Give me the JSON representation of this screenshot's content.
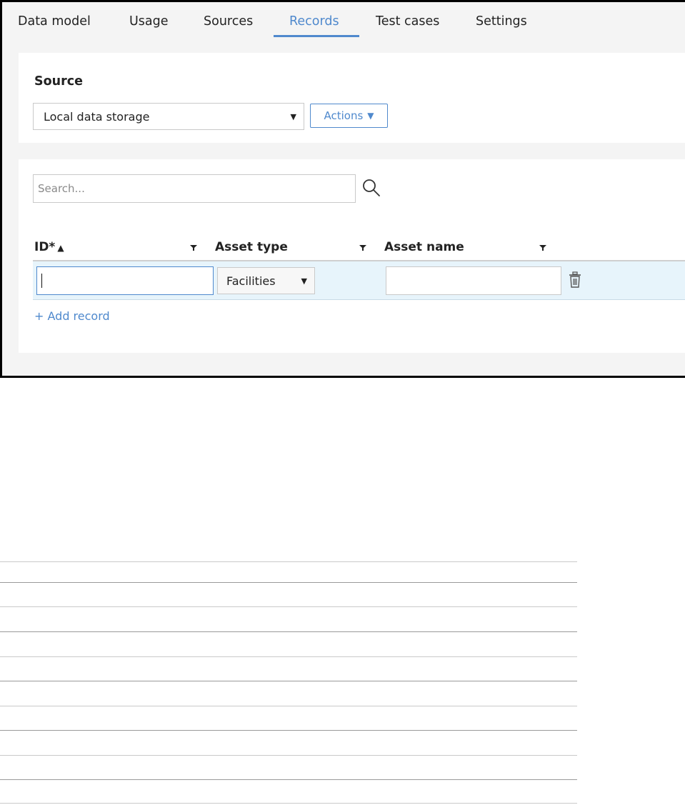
{
  "tabs": [
    {
      "label": "Data model",
      "active": false
    },
    {
      "label": "Usage",
      "active": false
    },
    {
      "label": "Sources",
      "active": false
    },
    {
      "label": "Records",
      "active": true
    },
    {
      "label": "Test cases",
      "active": false
    },
    {
      "label": "Settings",
      "active": false
    }
  ],
  "source": {
    "heading": "Source",
    "selected": "Local data storage",
    "actions_label": "Actions",
    "actions_icon": "triangle-down"
  },
  "records": {
    "search_placeholder": "Search...",
    "columns": [
      {
        "label": "ID*",
        "sort": "ascending"
      },
      {
        "label": "Asset type"
      },
      {
        "label": "Asset name"
      }
    ],
    "rows": [
      {
        "id": "",
        "asset_type": "Facilities",
        "asset_name": ""
      }
    ],
    "add_record_label": "+ Add record"
  },
  "colors": {
    "accent": "#4f89cd",
    "row_highlight": "#e7f4fb",
    "page_background": "#f4f4f4"
  },
  "icons": [
    "search-icon",
    "filter-icon",
    "sort-ascending-icon",
    "trash-icon",
    "caret-down-icon"
  ]
}
